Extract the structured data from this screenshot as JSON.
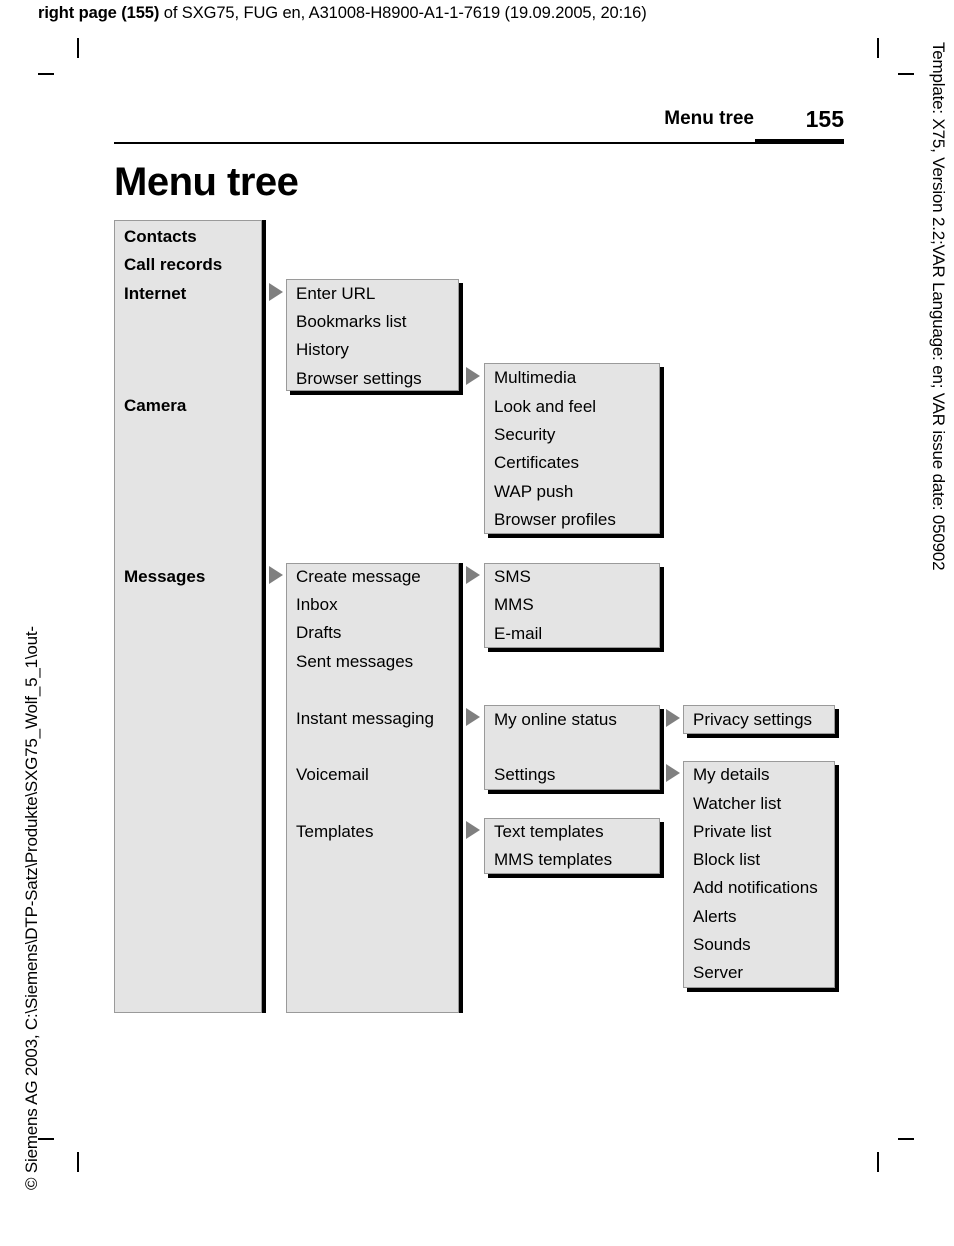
{
  "production_header": {
    "bold_prefix": "right page (155)",
    "rest": " of SXG75, FUG en, A31008-H8900-A1-1-7619 (19.09.2005, 20:16)"
  },
  "side_notes": {
    "left": "© Siemens AG 2003, C:\\Siemens\\DTP-Satz\\Produkte\\SXG75_Wolf_5_1\\out-",
    "right": "Template: X75, Version 2.2;VAR Language: en; VAR issue date: 050902"
  },
  "running_head": {
    "title": "Menu tree",
    "page_number": "155"
  },
  "page_title": "Menu tree",
  "menu_tree": {
    "level1": [
      {
        "label": "Contacts",
        "has_arrow": false
      },
      {
        "label": "Call records",
        "has_arrow": false
      },
      {
        "label": "Internet",
        "has_arrow": true
      },
      {
        "label": "Camera",
        "has_arrow": false
      },
      {
        "label": "Messages",
        "has_arrow": true
      }
    ],
    "internet": [
      {
        "label": "Enter URL",
        "has_arrow": false
      },
      {
        "label": "Bookmarks list",
        "has_arrow": false
      },
      {
        "label": "History",
        "has_arrow": false
      },
      {
        "label": "Browser settings",
        "has_arrow": true
      }
    ],
    "browser_settings": [
      {
        "label": "Multimedia"
      },
      {
        "label": "Look and feel"
      },
      {
        "label": "Security"
      },
      {
        "label": "Certificates"
      },
      {
        "label": "WAP push"
      },
      {
        "label": "Browser profiles"
      }
    ],
    "messages": [
      {
        "label": "Create message",
        "has_arrow": true
      },
      {
        "label": "Inbox",
        "has_arrow": false
      },
      {
        "label": "Drafts",
        "has_arrow": false
      },
      {
        "label": "Sent messages",
        "has_arrow": false
      },
      {
        "label": "Instant messaging",
        "has_arrow": true
      },
      {
        "label": "Voicemail",
        "has_arrow": false
      },
      {
        "label": "Templates",
        "has_arrow": true
      }
    ],
    "create_message": [
      {
        "label": "SMS"
      },
      {
        "label": "MMS"
      },
      {
        "label": "E-mail"
      }
    ],
    "instant_messaging": [
      {
        "label": "My online status",
        "has_arrow": true
      },
      {
        "label": "Settings",
        "has_arrow": true
      }
    ],
    "privacy": [
      {
        "label": "Privacy settings"
      }
    ],
    "im_settings": [
      {
        "label": "My details"
      },
      {
        "label": "Watcher list"
      },
      {
        "label": "Private list"
      },
      {
        "label": "Block list"
      },
      {
        "label": "Add notifications"
      },
      {
        "label": "Alerts"
      },
      {
        "label": "Sounds"
      },
      {
        "label": "Server"
      }
    ],
    "templates": [
      {
        "label": "Text templates"
      },
      {
        "label": "MMS templates"
      }
    ]
  },
  "colors": {
    "box_fill": "#e4e4e4",
    "box_border": "#9a9a9a",
    "shadow": "#000000",
    "arrow": "#7f7f7f"
  }
}
